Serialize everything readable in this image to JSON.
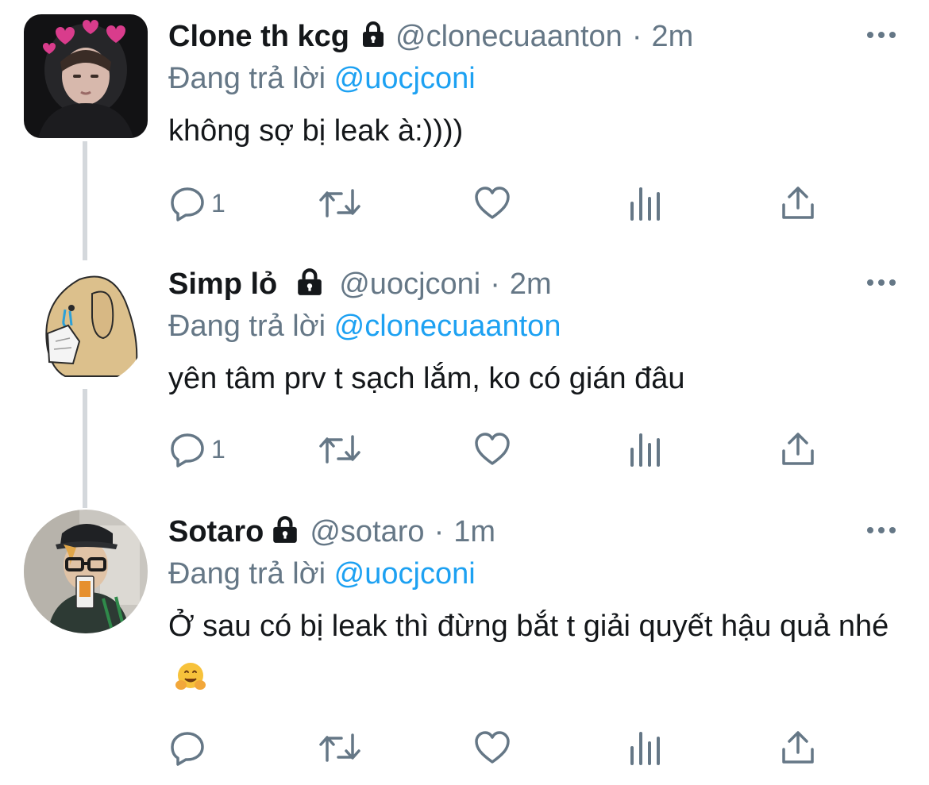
{
  "tweets": [
    {
      "display_name": "Clone th kcg",
      "handle": "@clonecuaanton",
      "separator": "·",
      "time": "2m",
      "replying_prefix": "Đang trả lời",
      "replying_to": "@uocjconi",
      "text": "không sợ bị leak à:))))",
      "reply_count": "1",
      "avatar": "photo of person in black hoodie with pink hearts"
    },
    {
      "display_name": "Simp lỏ",
      "handle": "@uocjconi",
      "separator": "·",
      "time": "2m",
      "replying_prefix": "Đang trả lời",
      "replying_to": "@clonecuaanton",
      "text": "yên tâm prv t sạch lắm, ko có gián đâu",
      "reply_count": "1",
      "avatar": "drawing of crying tan dog holding tissue"
    },
    {
      "display_name": "Sotaro",
      "handle": "@sotaro",
      "separator": "·",
      "time": "1m",
      "replying_prefix": "Đang trả lời",
      "replying_to": "@uocjconi",
      "text": "Ở sau có bị leak thì đừng bắt t giải quyết hậu quả nhé",
      "emoji": "hugging-face",
      "reply_count": "",
      "avatar": "photo of person with cap and glasses"
    }
  ],
  "colors": {
    "text": "#14171a",
    "secondary": "#657786",
    "link": "#1da1f2",
    "thread_line": "#d4d8dc"
  },
  "icons": [
    "lock-icon",
    "more-icon",
    "reply-icon",
    "retweet-icon",
    "like-icon",
    "analytics-icon",
    "share-icon"
  ]
}
